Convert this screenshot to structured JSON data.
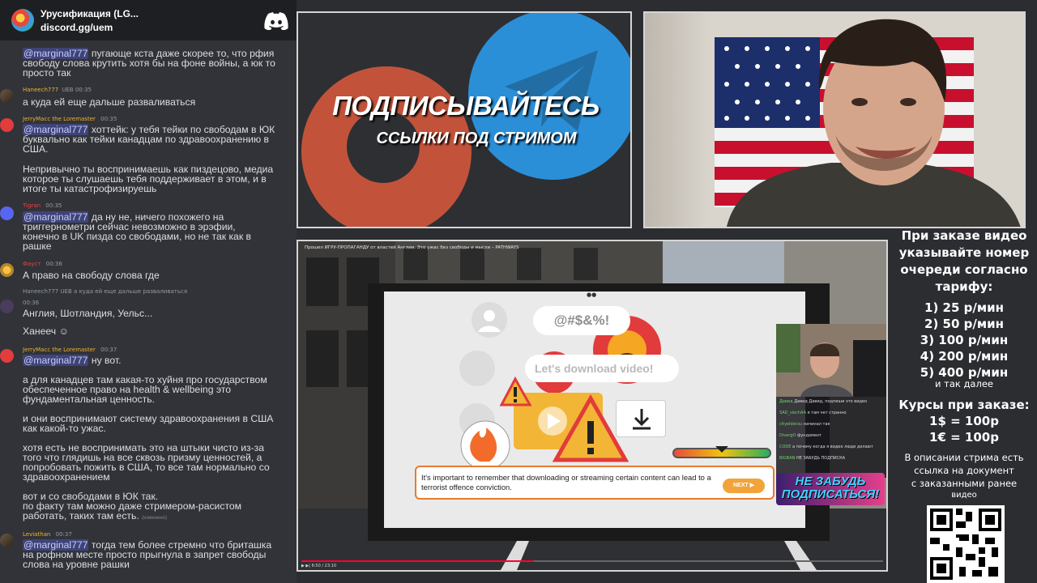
{
  "discord": {
    "server_name": "Урусификация (LG...",
    "invite": "discord.gg/uem"
  },
  "messages": [
    {
      "lines": [
        "@marginal777 пугающе кста даже скорее то, что рфия",
        "свободу слова крутить хотя бы на фоне войны, а юк то",
        "просто так"
      ]
    },
    {
      "user": "Haneech777",
      "badge": "UEB",
      "time": "00:35",
      "lines": [
        "а куда ей еще дальше разваливаться"
      ]
    },
    {
      "user": "JerryMacc the Loremaster",
      "time": "00:35",
      "lines": [
        "@marginal777 хоттейк: у тебя тейки по свободам в ЮК",
        "буквально как тейки канадцам по здравоохранению в",
        "США.",
        "",
        "Непривычно ты воспринимаешь как пиздецово, медиа",
        "которое ты слушаешь тебя поддерживает в этом, и в",
        "итоге ты катастрофизируешь"
      ]
    },
    {
      "user": "Tigran",
      "time": "00:35",
      "lines": [
        "@marginal777 да ну не, ничего похожего на",
        "триггернометри сейчас невозможно в эрэфии,",
        "конечно в UK пизда со свободами, но не так как в",
        "рашке"
      ]
    },
    {
      "user": "Фауст",
      "time": "00:36",
      "lines": [
        "А право на свободу слова где"
      ]
    },
    {
      "reply": "Haneech777 UEB а куда ей еще дальше разваливаться",
      "time": "00:36",
      "lines": [
        "Англия, Шотландия, Уельс...",
        "",
        "Ханееч"
      ]
    },
    {
      "user": "JerryMacc the Loremaster",
      "time": "00:37",
      "lines": [
        "@marginal777 ну вот.",
        "",
        "а для канадцев там какая-то хуйня про государством",
        "обеспеченное право на health & wellbeing это",
        "фундаментальная ценность.",
        "",
        "и они воспринимают систему здравоохранения в США",
        "как какой-то ужас.",
        "",
        "хотя есть не воспринимать это на штыки чисто из-за",
        "того что глядишь на все сквозь призму ценностей, а",
        "попробовать пожить в США, то все там нормально со",
        "здравоохранением",
        "",
        "вот и со свободами в ЮК так.",
        "по факту там можно даже стримером-расистом",
        "работать, таких там есть."
      ],
      "edited": "(изменено)"
    },
    {
      "user": "Leviathan",
      "time": "00:37",
      "lines": [
        "@marginal777 тогда тем более стремно что бриташка",
        "на рофном месте просто прыгнула в запрет свободы",
        "слова на уровне рашки"
      ]
    }
  ],
  "promo": {
    "title": "ПОДПИСЫВАЙТЕСЬ",
    "subtitle": "ССЫЛКИ ПОД СТРИМОМ"
  },
  "video": {
    "title": "Прошел ИГРУ-ПРОПАГАНДУ от властей Англии. Это ужас без свободы и мысли – PATHWAYS",
    "symbols": "@#$&%!",
    "download_bubble": "Let's download video!",
    "warning_text": "It's important to remember that downloading or streaming certain content can lead to a terrorist offence conviction.",
    "next_button": "NEXT",
    "player_time": "6:50 / 23:10",
    "progress": 0.4,
    "sub_banner": "НЕ ЗАБУДЬ ПОДПИСАТЬСЯ!",
    "mini_chat": [
      {
        "user": "Давид",
        "text": "Давид Давид, подпиши это видео"
      },
      {
        "user": "SAD_slechAA",
        "text": "я там чет странно"
      },
      {
        "user": "cityeldecsu",
        "text": "начинал так"
      },
      {
        "user": "DivergO",
        "text": "фундамент"
      },
      {
        "user": "CODE",
        "text": "а почему когда я видео люди делают"
      },
      {
        "user": "BIGBAN",
        "text": "НЕ ЗАБУДЬ ПОДПИСКА"
      }
    ]
  },
  "info": {
    "order_text": [
      "При заказе видео",
      "указывайте номер",
      "очереди согласно",
      "тарифу:"
    ],
    "tariffs": [
      "1) 25 р/мин",
      "2) 50 р/мин",
      "3) 100 р/мин",
      "4) 200 р/мин",
      "5) 400 р/мин"
    ],
    "etc": "и так далее",
    "rates_title": "Курсы при заказе:",
    "rates": [
      "1$ = 100р",
      "1€ = 100р"
    ],
    "description": [
      "В описании стрима есть",
      "ссылка на документ",
      "с заказанными ранее",
      "видео"
    ]
  },
  "colors": {
    "discord_bg": "#313338",
    "mention": "#c9cdfb",
    "promo_red": "#c2533a",
    "promo_blue": "#2b8fd8",
    "warning_orange": "#e87a2f"
  }
}
